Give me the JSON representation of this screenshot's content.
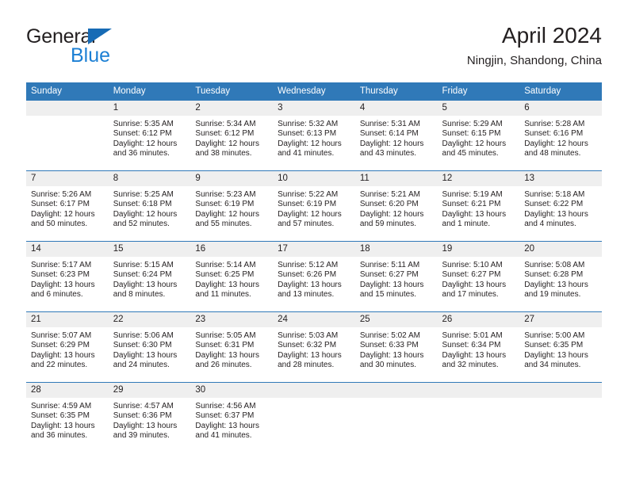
{
  "brand": {
    "name_part1": "General",
    "name_part2": "Blue"
  },
  "header": {
    "title": "April 2024",
    "location": "Ningjin, Shandong, China"
  },
  "colors": {
    "header_blue": "#3079b8",
    "logo_blue": "#1b7fd4",
    "daynum_band": "#efefef",
    "text": "#231f20"
  },
  "weekday_headers": [
    "Sunday",
    "Monday",
    "Tuesday",
    "Wednesday",
    "Thursday",
    "Friday",
    "Saturday"
  ],
  "labels": {
    "sunrise_prefix": "Sunrise:",
    "sunset_prefix": "Sunset:",
    "daylight_prefix": "Daylight:"
  },
  "weeks": [
    [
      {
        "day": "",
        "sunrise": "",
        "sunset": "",
        "daylight": ""
      },
      {
        "day": "1",
        "sunrise": "Sunrise: 5:35 AM",
        "sunset": "Sunset: 6:12 PM",
        "daylight": "Daylight: 12 hours and 36 minutes."
      },
      {
        "day": "2",
        "sunrise": "Sunrise: 5:34 AM",
        "sunset": "Sunset: 6:12 PM",
        "daylight": "Daylight: 12 hours and 38 minutes."
      },
      {
        "day": "3",
        "sunrise": "Sunrise: 5:32 AM",
        "sunset": "Sunset: 6:13 PM",
        "daylight": "Daylight: 12 hours and 41 minutes."
      },
      {
        "day": "4",
        "sunrise": "Sunrise: 5:31 AM",
        "sunset": "Sunset: 6:14 PM",
        "daylight": "Daylight: 12 hours and 43 minutes."
      },
      {
        "day": "5",
        "sunrise": "Sunrise: 5:29 AM",
        "sunset": "Sunset: 6:15 PM",
        "daylight": "Daylight: 12 hours and 45 minutes."
      },
      {
        "day": "6",
        "sunrise": "Sunrise: 5:28 AM",
        "sunset": "Sunset: 6:16 PM",
        "daylight": "Daylight: 12 hours and 48 minutes."
      }
    ],
    [
      {
        "day": "7",
        "sunrise": "Sunrise: 5:26 AM",
        "sunset": "Sunset: 6:17 PM",
        "daylight": "Daylight: 12 hours and 50 minutes."
      },
      {
        "day": "8",
        "sunrise": "Sunrise: 5:25 AM",
        "sunset": "Sunset: 6:18 PM",
        "daylight": "Daylight: 12 hours and 52 minutes."
      },
      {
        "day": "9",
        "sunrise": "Sunrise: 5:23 AM",
        "sunset": "Sunset: 6:19 PM",
        "daylight": "Daylight: 12 hours and 55 minutes."
      },
      {
        "day": "10",
        "sunrise": "Sunrise: 5:22 AM",
        "sunset": "Sunset: 6:19 PM",
        "daylight": "Daylight: 12 hours and 57 minutes."
      },
      {
        "day": "11",
        "sunrise": "Sunrise: 5:21 AM",
        "sunset": "Sunset: 6:20 PM",
        "daylight": "Daylight: 12 hours and 59 minutes."
      },
      {
        "day": "12",
        "sunrise": "Sunrise: 5:19 AM",
        "sunset": "Sunset: 6:21 PM",
        "daylight": "Daylight: 13 hours and 1 minute."
      },
      {
        "day": "13",
        "sunrise": "Sunrise: 5:18 AM",
        "sunset": "Sunset: 6:22 PM",
        "daylight": "Daylight: 13 hours and 4 minutes."
      }
    ],
    [
      {
        "day": "14",
        "sunrise": "Sunrise: 5:17 AM",
        "sunset": "Sunset: 6:23 PM",
        "daylight": "Daylight: 13 hours and 6 minutes."
      },
      {
        "day": "15",
        "sunrise": "Sunrise: 5:15 AM",
        "sunset": "Sunset: 6:24 PM",
        "daylight": "Daylight: 13 hours and 8 minutes."
      },
      {
        "day": "16",
        "sunrise": "Sunrise: 5:14 AM",
        "sunset": "Sunset: 6:25 PM",
        "daylight": "Daylight: 13 hours and 11 minutes."
      },
      {
        "day": "17",
        "sunrise": "Sunrise: 5:12 AM",
        "sunset": "Sunset: 6:26 PM",
        "daylight": "Daylight: 13 hours and 13 minutes."
      },
      {
        "day": "18",
        "sunrise": "Sunrise: 5:11 AM",
        "sunset": "Sunset: 6:27 PM",
        "daylight": "Daylight: 13 hours and 15 minutes."
      },
      {
        "day": "19",
        "sunrise": "Sunrise: 5:10 AM",
        "sunset": "Sunset: 6:27 PM",
        "daylight": "Daylight: 13 hours and 17 minutes."
      },
      {
        "day": "20",
        "sunrise": "Sunrise: 5:08 AM",
        "sunset": "Sunset: 6:28 PM",
        "daylight": "Daylight: 13 hours and 19 minutes."
      }
    ],
    [
      {
        "day": "21",
        "sunrise": "Sunrise: 5:07 AM",
        "sunset": "Sunset: 6:29 PM",
        "daylight": "Daylight: 13 hours and 22 minutes."
      },
      {
        "day": "22",
        "sunrise": "Sunrise: 5:06 AM",
        "sunset": "Sunset: 6:30 PM",
        "daylight": "Daylight: 13 hours and 24 minutes."
      },
      {
        "day": "23",
        "sunrise": "Sunrise: 5:05 AM",
        "sunset": "Sunset: 6:31 PM",
        "daylight": "Daylight: 13 hours and 26 minutes."
      },
      {
        "day": "24",
        "sunrise": "Sunrise: 5:03 AM",
        "sunset": "Sunset: 6:32 PM",
        "daylight": "Daylight: 13 hours and 28 minutes."
      },
      {
        "day": "25",
        "sunrise": "Sunrise: 5:02 AM",
        "sunset": "Sunset: 6:33 PM",
        "daylight": "Daylight: 13 hours and 30 minutes."
      },
      {
        "day": "26",
        "sunrise": "Sunrise: 5:01 AM",
        "sunset": "Sunset: 6:34 PM",
        "daylight": "Daylight: 13 hours and 32 minutes."
      },
      {
        "day": "27",
        "sunrise": "Sunrise: 5:00 AM",
        "sunset": "Sunset: 6:35 PM",
        "daylight": "Daylight: 13 hours and 34 minutes."
      }
    ],
    [
      {
        "day": "28",
        "sunrise": "Sunrise: 4:59 AM",
        "sunset": "Sunset: 6:35 PM",
        "daylight": "Daylight: 13 hours and 36 minutes."
      },
      {
        "day": "29",
        "sunrise": "Sunrise: 4:57 AM",
        "sunset": "Sunset: 6:36 PM",
        "daylight": "Daylight: 13 hours and 39 minutes."
      },
      {
        "day": "30",
        "sunrise": "Sunrise: 4:56 AM",
        "sunset": "Sunset: 6:37 PM",
        "daylight": "Daylight: 13 hours and 41 minutes."
      },
      {
        "day": "",
        "sunrise": "",
        "sunset": "",
        "daylight": ""
      },
      {
        "day": "",
        "sunrise": "",
        "sunset": "",
        "daylight": ""
      },
      {
        "day": "",
        "sunrise": "",
        "sunset": "",
        "daylight": ""
      },
      {
        "day": "",
        "sunrise": "",
        "sunset": "",
        "daylight": ""
      }
    ]
  ]
}
